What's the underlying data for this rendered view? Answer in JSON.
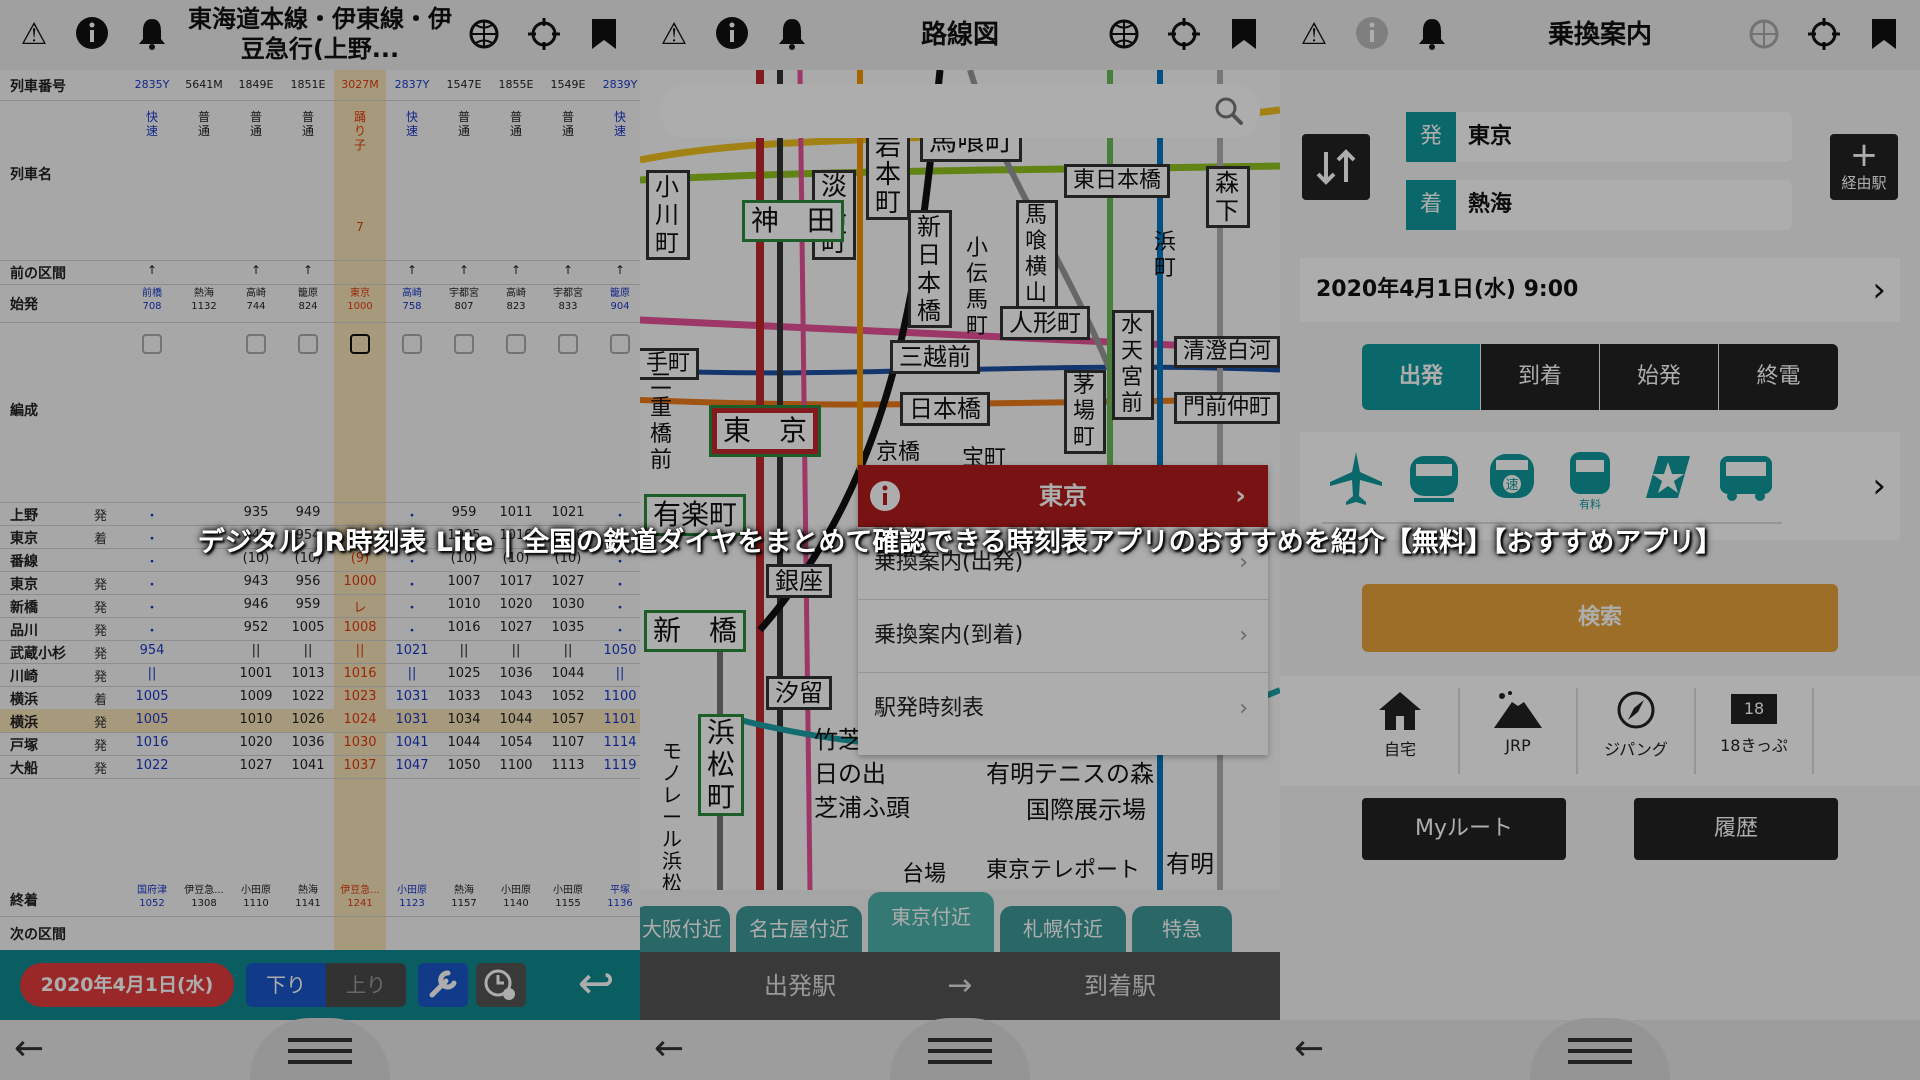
{
  "colors": {
    "accent_teal": "#0f8a8f",
    "popup_red": "#b31d1d",
    "search_orange": "#e8a33c",
    "dark": "#222222"
  },
  "timetable": {
    "title": "東海道本線・伊東線・伊豆急行(上野...",
    "labels": {
      "train_no": "列車番号",
      "train_name": "列車名",
      "prev": "前の区間",
      "origin": "始発",
      "formation": "編成",
      "track": "番線",
      "terminal": "終着",
      "next": "次の区間"
    },
    "train_numbers": [
      "2835Y",
      "5641M",
      "1849E",
      "1851E",
      "3027M",
      "2837Y",
      "1547E",
      "1855E",
      "1549E",
      "2839Y"
    ],
    "train_names": [
      "快速",
      "普通",
      "普通",
      "普通",
      "踊り子",
      "快速",
      "普通",
      "普通",
      "普通",
      "快速"
    ],
    "prev": [
      "↑",
      "",
      "↑",
      "↑",
      "",
      "↑",
      "↑",
      "↑",
      "↑",
      "↑"
    ],
    "origins": [
      "前橋\n708",
      "熱海\n1132",
      "高崎\n744",
      "籠原\n824",
      "東京\n1000",
      "高崎\n758",
      "宇都宮\n807",
      "高崎\n823",
      "宇都宮\n833",
      "籠原\n904"
    ],
    "train_name_extra": "7",
    "stations": [
      {
        "name": "上野",
        "type": "発",
        "times": [
          "・",
          "",
          "935",
          "949",
          "",
          "・",
          "959",
          "1011",
          "1021",
          "・"
        ]
      },
      {
        "name": "東京",
        "type": "着",
        "times": [
          "・",
          "",
          "941",
          "954",
          "",
          "・",
          "1005",
          "1016",
          "1026",
          "・"
        ]
      },
      {
        "name": "番線",
        "type": "",
        "times": [
          "・",
          "",
          "(10)",
          "(10)",
          "(9)",
          "・",
          "(10)",
          "(10)",
          "(10)",
          "・"
        ]
      },
      {
        "name": "東京",
        "type": "発",
        "times": [
          "・",
          "",
          "943",
          "956",
          "1000",
          "・",
          "1007",
          "1017",
          "1027",
          "・"
        ]
      },
      {
        "name": "新橋",
        "type": "発",
        "times": [
          "・",
          "",
          "946",
          "959",
          "レ",
          "・",
          "1010",
          "1020",
          "1030",
          "・"
        ]
      },
      {
        "name": "品川",
        "type": "発",
        "times": [
          "・",
          "",
          "952",
          "1005",
          "1008",
          "・",
          "1016",
          "1027",
          "1035",
          "・"
        ]
      },
      {
        "name": "武蔵小杉",
        "type": "発",
        "times": [
          "954",
          "",
          "||",
          "||",
          "||",
          "1021",
          "||",
          "||",
          "||",
          "1050"
        ]
      },
      {
        "name": "川崎",
        "type": "発",
        "times": [
          "||",
          "",
          "1001",
          "1013",
          "1016",
          "||",
          "1025",
          "1036",
          "1044",
          "||"
        ]
      },
      {
        "name": "横浜",
        "type": "着",
        "times": [
          "1005",
          "",
          "1009",
          "1022",
          "1023",
          "1031",
          "1033",
          "1043",
          "1052",
          "1100"
        ]
      },
      {
        "name": "横浜",
        "type": "発",
        "times": [
          "1005",
          "",
          "1010",
          "1026",
          "1024",
          "1031",
          "1034",
          "1044",
          "1057",
          "1101"
        ]
      },
      {
        "name": "戸塚",
        "type": "発",
        "times": [
          "1016",
          "",
          "1020",
          "1036",
          "1030",
          "1041",
          "1044",
          "1054",
          "1107",
          "1114"
        ]
      },
      {
        "name": "大船",
        "type": "発",
        "times": [
          "1022",
          "",
          "1027",
          "1041",
          "1037",
          "1047",
          "1050",
          "1100",
          "1113",
          "1119"
        ]
      }
    ],
    "terminals": [
      "国府津\n1052",
      "伊豆急...\n1308",
      "小田原\n1110",
      "熱海\n1141",
      "伊豆急...\n1241",
      "小田原\n1123",
      "熱海\n1157",
      "小田原\n1140",
      "小田原\n1155",
      "平塚\n1136"
    ],
    "date_button": "2020年4月1日(水)",
    "dir_down": "下り",
    "dir_up": "上り"
  },
  "map": {
    "title": "路線図",
    "stations": [
      "馬喰町",
      "東日本橋",
      "岩本町",
      "淡路町",
      "小川町",
      "神　田",
      "新日本橋",
      "小伝馬町",
      "馬喰横山",
      "浜町",
      "森下",
      "人形町",
      "水天宮前",
      "清澄白河",
      "三越前",
      "手町",
      "日本橋",
      "茅場町",
      "門前仲町",
      "東　京",
      "京橋",
      "宝町",
      "有楽町",
      "銀座",
      "新　橋",
      "汐留",
      "浜松町",
      "竹芝",
      "日の出",
      "芝浦ふ頭",
      "有明テニスの森",
      "国際展示場",
      "東京テレポート",
      "有明",
      "台場",
      "モノレール浜松町",
      "二重橋前"
    ],
    "popup": {
      "title": "東京",
      "items": [
        "乗換案内(出発)",
        "乗換案内(到着)",
        "駅発時刻表"
      ]
    },
    "tabs": [
      "大阪付近",
      "名古屋付近",
      "東京付近",
      "札幌付近",
      "特急"
    ],
    "from_label": "出発駅",
    "to_label": "到着駅",
    "arrow": "→"
  },
  "transfer": {
    "title": "乗換案内",
    "from_tag": "発",
    "from_station": "東京",
    "to_tag": "着",
    "to_station": "熱海",
    "via_label": "経由駅",
    "datetime": "2020年4月1日(水) 9:00",
    "modes": [
      "出発",
      "到着",
      "始発",
      "終電"
    ],
    "transport_icons": [
      "airplane-icon",
      "shinkansen-icon",
      "express-icon",
      "paid-express-icon",
      "limited-express-icon",
      "bus-icon"
    ],
    "paid_label": "有料",
    "express_label": "速",
    "search_button": "検索",
    "shortcuts": [
      "自宅",
      "JRP",
      "ジパング",
      "18きっぷ"
    ],
    "eighteen_label": "18",
    "my_route": "Myルート",
    "history": "履歴"
  },
  "caption": "デジタル JR時刻表 Lite | 全国の鉄道ダイヤをまとめて確認できる時刻表アプリのおすすめを紹介【無料】【おすすめアプリ】"
}
